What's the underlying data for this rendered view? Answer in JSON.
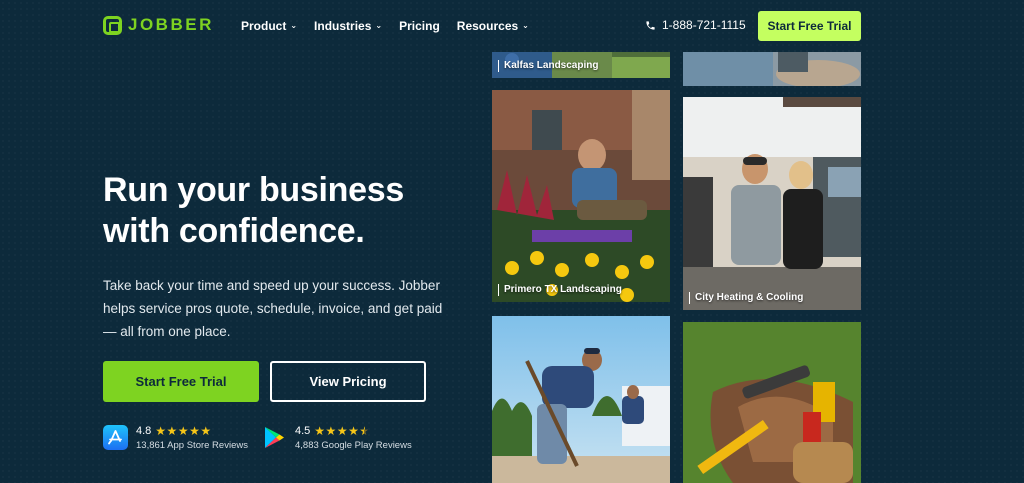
{
  "nav": {
    "logo_text": "JOBBER",
    "menu": [
      {
        "label": "Product",
        "has_dropdown": true
      },
      {
        "label": "Industries",
        "has_dropdown": true
      },
      {
        "label": "Pricing",
        "has_dropdown": false
      },
      {
        "label": "Resources",
        "has_dropdown": true
      }
    ],
    "phone": "1-888-721-1115",
    "cta": "Start Free Trial"
  },
  "hero": {
    "headline": "Run your business with confidence.",
    "subtext": "Take back your time and speed up your success. Jobber helps service pros quote, schedule, invoice, and get paid — all from one place.",
    "primary_button": "Start Free Trial",
    "secondary_button": "View Pricing"
  },
  "ratings": {
    "app_store": {
      "score": "4.8",
      "stars": 5,
      "reviews": "13,861 App Store Reviews",
      "icon": "app-store-icon"
    },
    "google_play": {
      "score": "4.5",
      "stars": 4.5,
      "reviews": "4,883 Google Play Reviews",
      "icon": "google-play-icon"
    }
  },
  "photos": [
    {
      "caption": "Kalfas Landscaping"
    },
    {
      "caption": ""
    },
    {
      "caption": "Primero TX Landscaping"
    },
    {
      "caption": "City Heating & Cooling"
    },
    {
      "caption": ""
    },
    {
      "caption": ""
    }
  ],
  "colors": {
    "background": "#0d2a3b",
    "brand_green": "#7ed321",
    "nav_cta": "#c4ff60",
    "star": "#f5c518"
  }
}
